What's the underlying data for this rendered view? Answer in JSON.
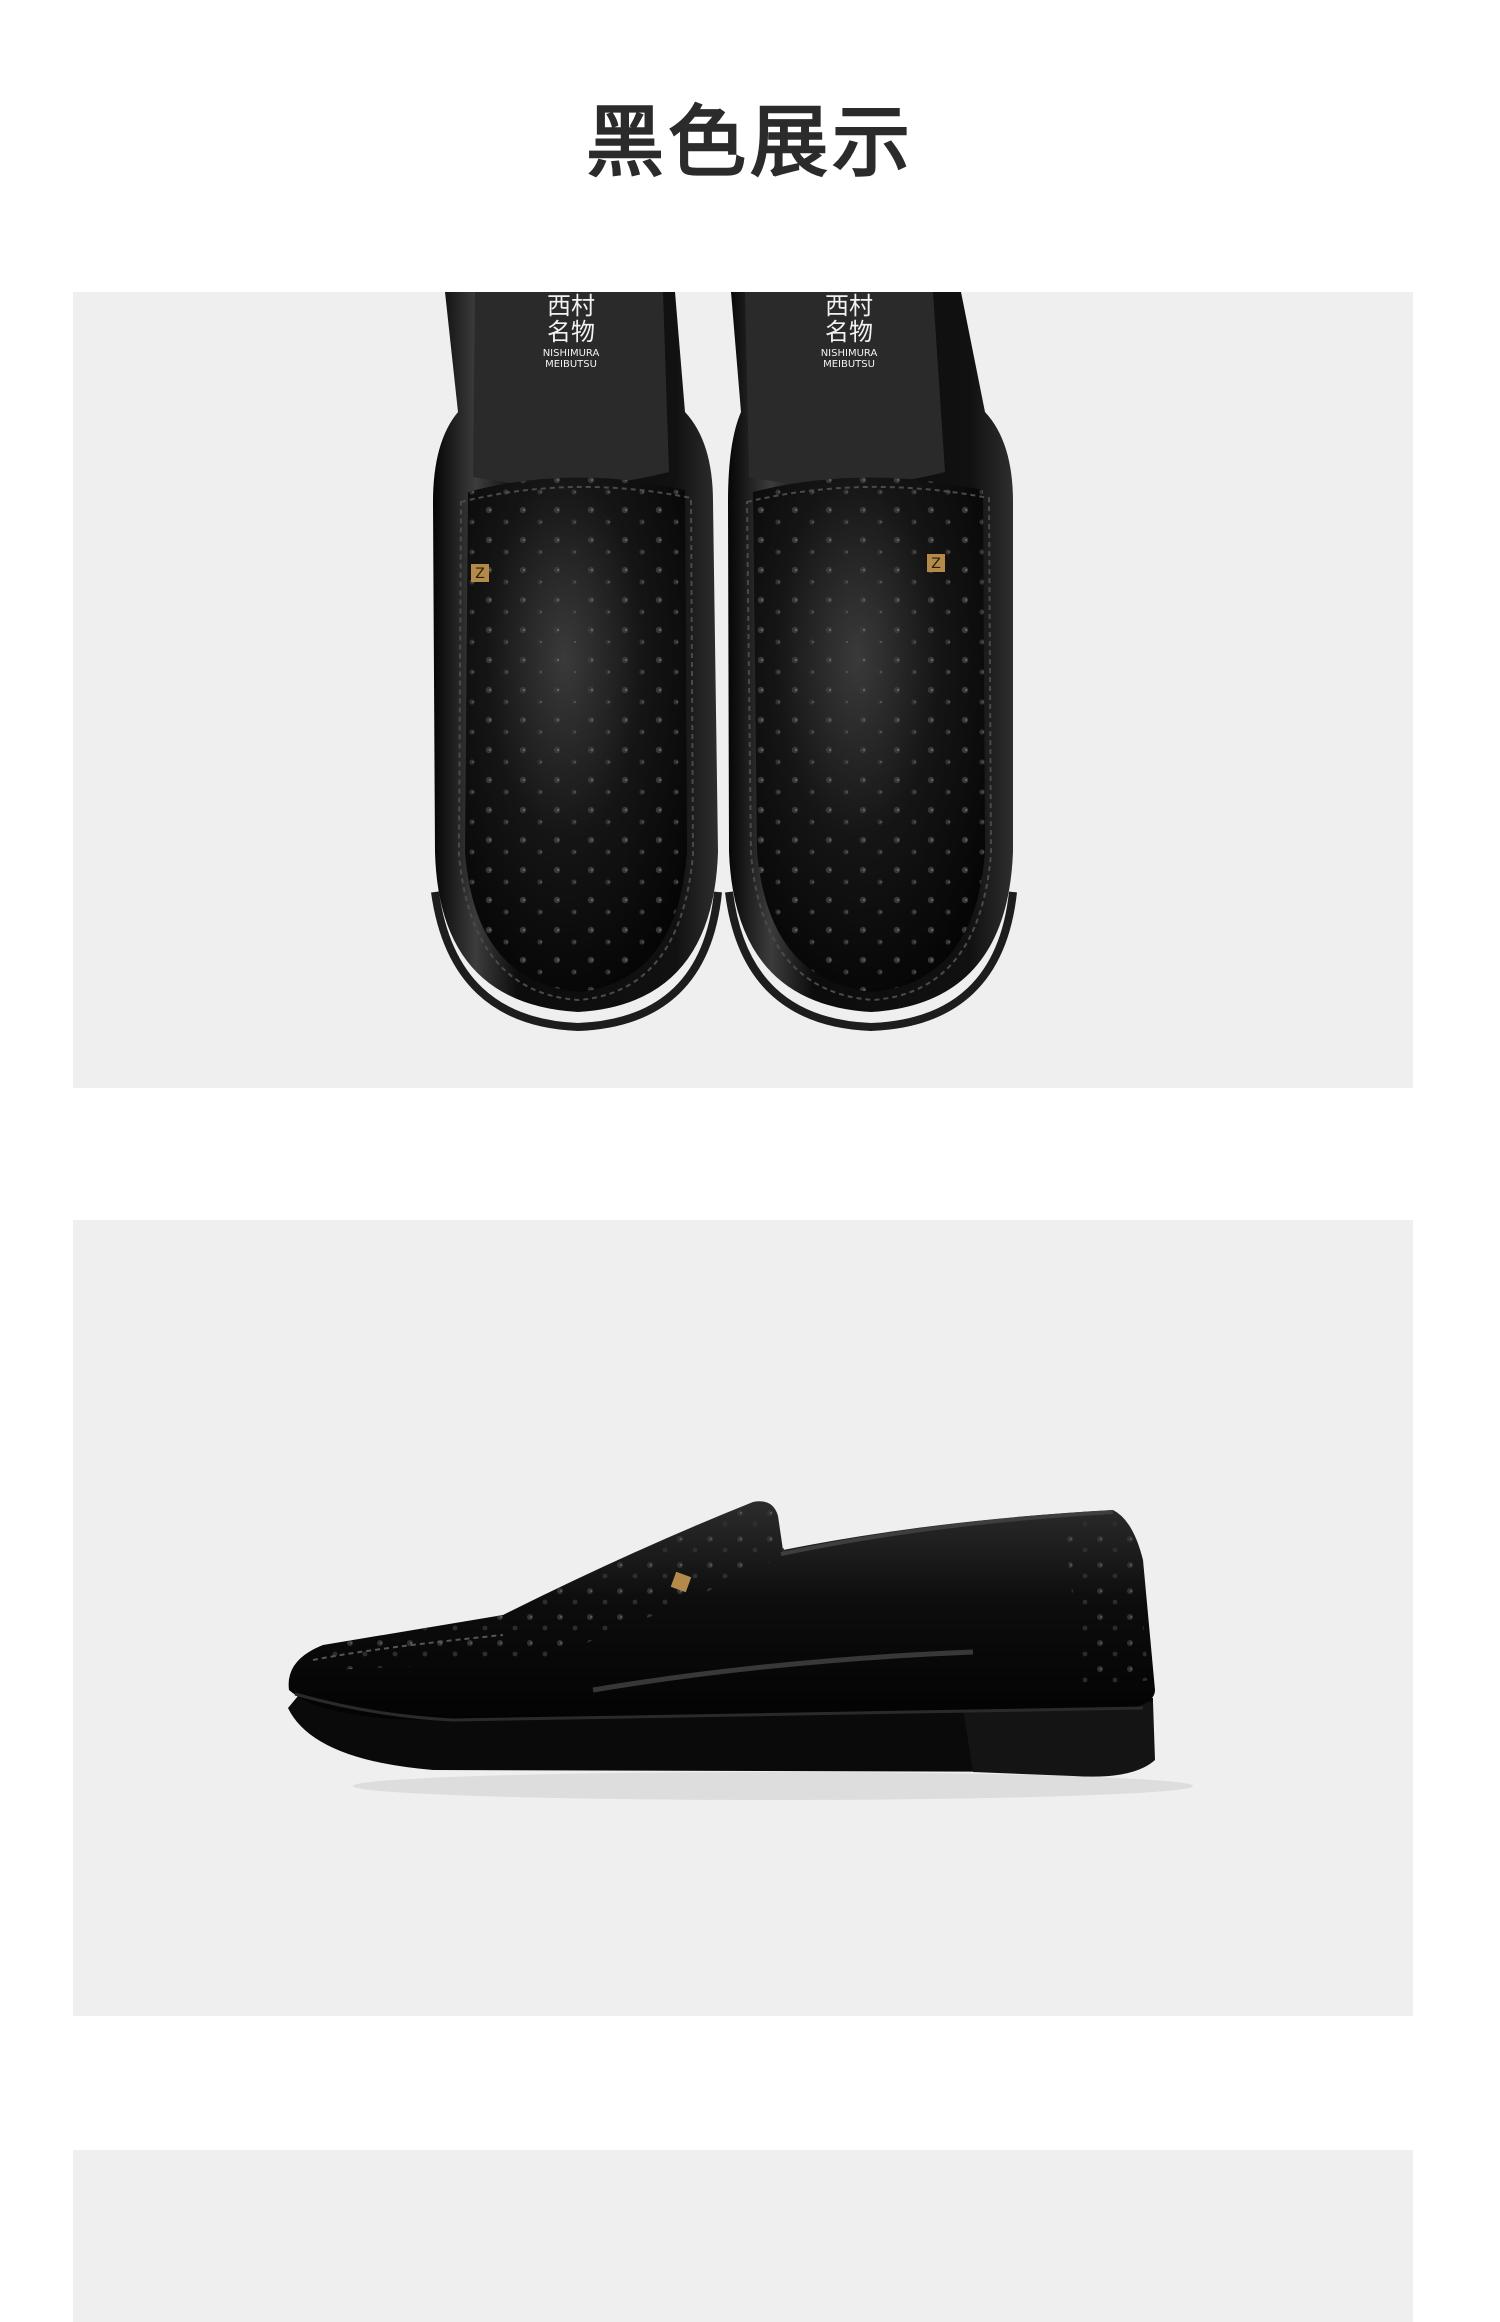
{
  "page": {
    "title": "黑色展示"
  },
  "insole_logo": {
    "cn_line1": "西村",
    "cn_line2": "名物",
    "en_line1": "NISHIMURA",
    "en_line2": "MEIBUTSU"
  },
  "colors": {
    "panel_background": "#efefef",
    "title_text": "#2b2b2b",
    "shoe_black": "#0c0c0c",
    "insole": "#2a2a2a",
    "badge_gold": "#b48a4a"
  }
}
